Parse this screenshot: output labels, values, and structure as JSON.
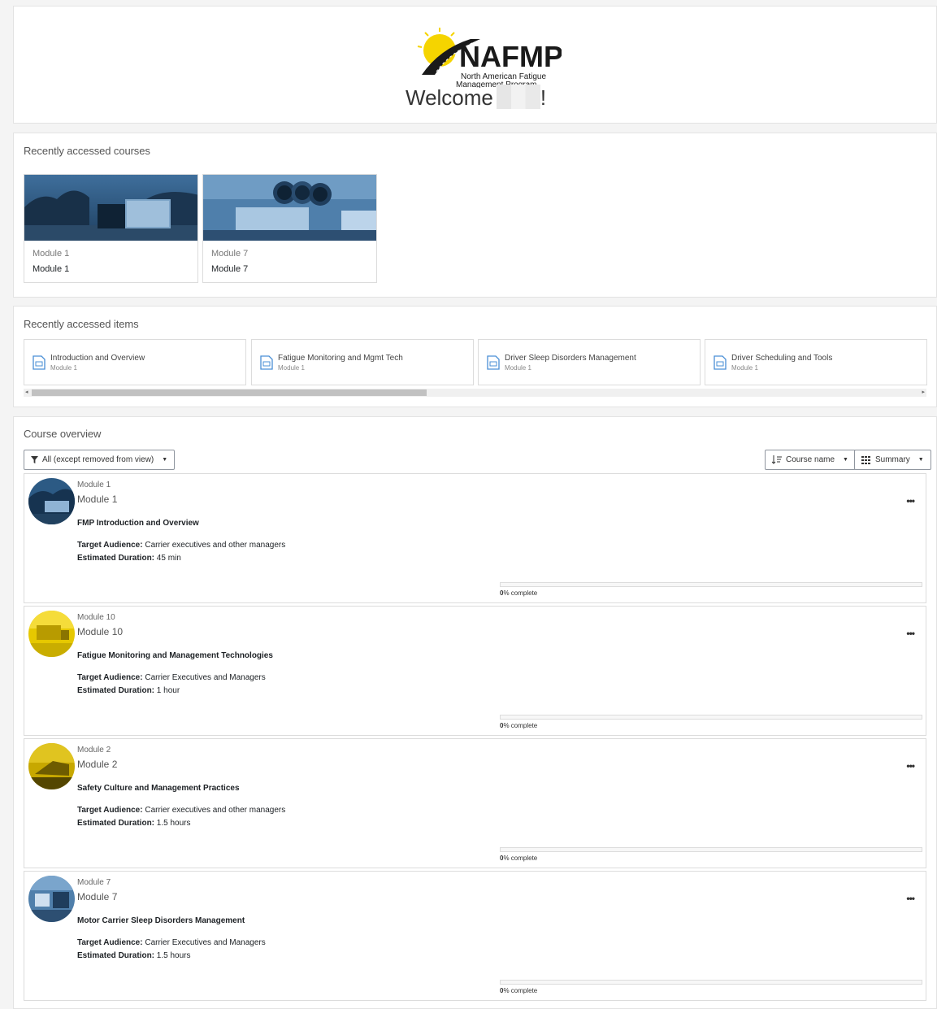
{
  "header": {
    "logo_text": "NAFMP",
    "logo_subtitle_1": "North American Fatigue",
    "logo_subtitle_2": "Management Program",
    "welcome": "Welcome",
    "exclaim": "!"
  },
  "recent_courses": {
    "title": "Recently accessed courses",
    "items": [
      {
        "category": "Module 1",
        "name": "Module 1"
      },
      {
        "category": "Module 7",
        "name": "Module 7"
      }
    ]
  },
  "recent_items": {
    "title": "Recently accessed items",
    "items": [
      {
        "title": "Introduction and Overview",
        "course": "Module 1"
      },
      {
        "title": "Fatigue Monitoring and Mgmt Tech",
        "course": "Module 1"
      },
      {
        "title": "Driver Sleep Disorders Management",
        "course": "Module 1"
      },
      {
        "title": "Driver Scheduling and Tools",
        "course": "Module 1"
      }
    ],
    "scroll_left": "◂",
    "scroll_right": "▸"
  },
  "course_overview": {
    "title": "Course overview",
    "filter_label": "All (except removed from view)",
    "sort_label": "Course name",
    "view_label": "Summary",
    "target_label": "Target Audience:",
    "duration_label": "Estimated Duration:",
    "complete_suffix": "% complete",
    "menu_label": "•••",
    "courses": [
      {
        "category": "Module 1",
        "name": "Module 1",
        "summary": "FMP Introduction and Overview",
        "audience": "Carrier executives and other managers",
        "duration": "45 min",
        "progress": 0
      },
      {
        "category": "Module 10",
        "name": "Module 10",
        "summary": "Fatigue Monitoring and Management Technologies",
        "audience": "Carrier Executives and Managers",
        "duration": "1 hour",
        "progress": 0
      },
      {
        "category": "Module 2",
        "name": "Module 2",
        "summary": "Safety Culture and Management Practices",
        "audience": "Carrier executives and other managers",
        "duration": "1.5 hours",
        "progress": 0
      },
      {
        "category": "Module 7",
        "name": "Module 7",
        "summary": "Motor Carrier Sleep Disorders Management",
        "audience": "Carrier Executives and Managers",
        "duration": "1.5 hours",
        "progress": 0
      }
    ]
  },
  "colors": {
    "accent": "#0f6cbf",
    "logo_yellow": "#f5d400",
    "logo_dark": "#1a1a1a"
  }
}
